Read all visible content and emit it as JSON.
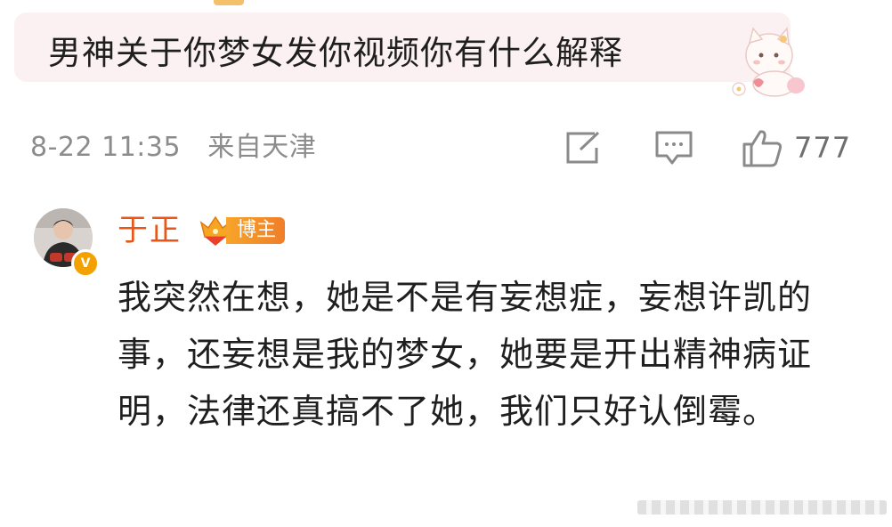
{
  "comment": {
    "text": "男神关于你梦女发你视频你有什么解释",
    "date": "8-22 11:35",
    "location": "来自天津",
    "like_count": "777",
    "icons": {
      "share": "share-edit-icon",
      "comment": "comment-icon",
      "like": "thumbs-up-icon"
    }
  },
  "reply": {
    "author": "于正",
    "badge_label": "博主",
    "text": "我突然在想，她是不是有妄想症，妄想许凯的事，还妄想是我的梦女，她要是开出精神病证明，法律还真搞不了她，我们只好认倒霉。"
  },
  "colors": {
    "bubble_bg": "#fbf1f2",
    "author_name": "#e8561a",
    "meta_gray": "#8c8c8c",
    "badge_orange": "#f7a52a"
  }
}
